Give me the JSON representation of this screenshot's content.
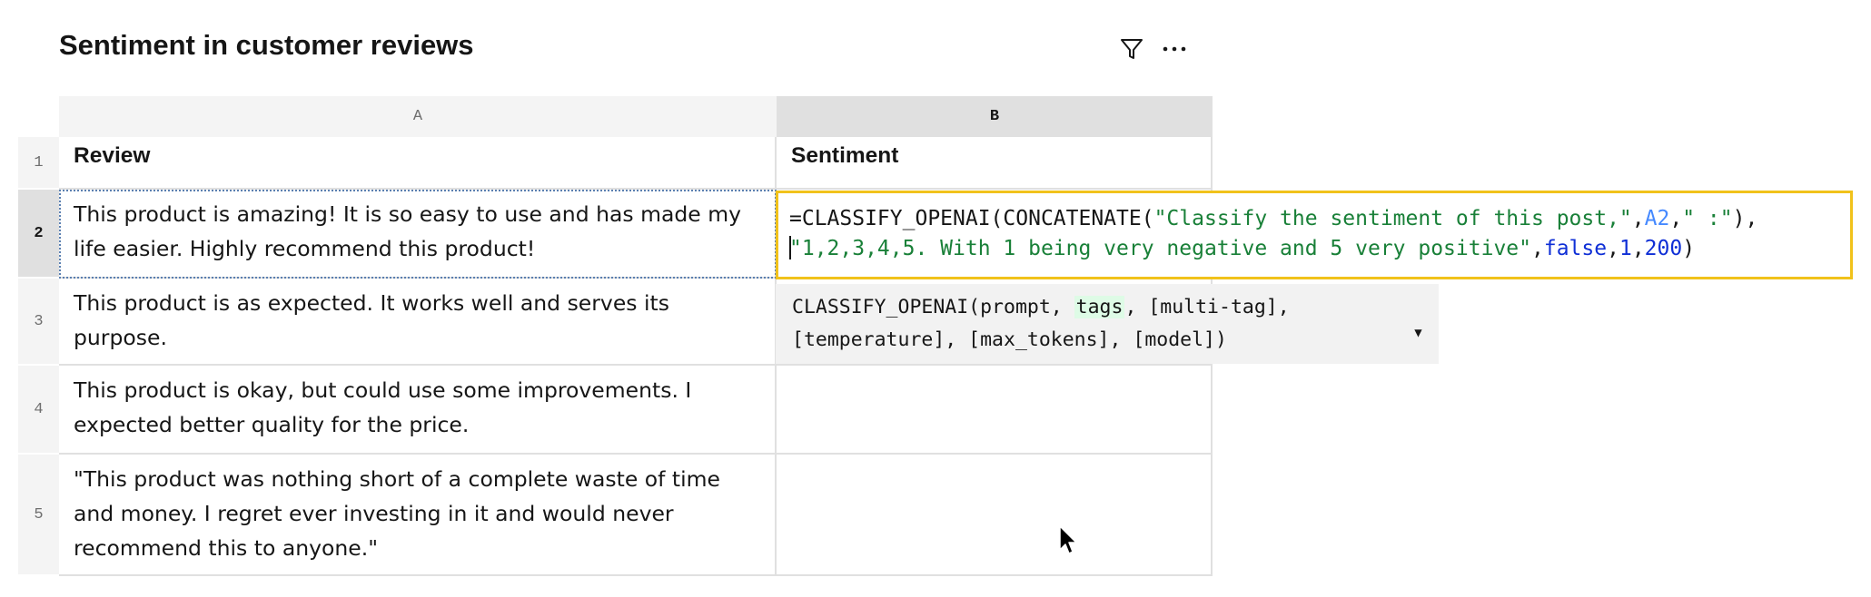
{
  "title": "Sentiment in customer reviews",
  "toolbar": {
    "filter_icon": "filter-icon",
    "more_icon": "more-horizontal-icon"
  },
  "columns": [
    "A",
    "B"
  ],
  "rows": [
    {
      "num": "1",
      "a": "Review",
      "b": "Sentiment"
    },
    {
      "num": "2",
      "a": "This product is amazing! It is so easy to use and has made my life easier. Highly recommend this product!",
      "b": ""
    },
    {
      "num": "3",
      "a": "This product is as expected. It works well and serves its purpose.",
      "b": ""
    },
    {
      "num": "4",
      "a": "This product is okay, but could use some improvements. I expected better quality for the price.",
      "b": ""
    },
    {
      "num": "5",
      "a": "\"This product was nothing short of a complete waste of time and money. I regret ever investing in it and would never recommend this to anyone.\"",
      "b": ""
    }
  ],
  "formula": {
    "line1": {
      "p1": "=CLASSIFY_OPENAI(CONCATENATE(",
      "s1": "\"Classify the sentiment of this post,\"",
      "c1": ",",
      "ref": "A2",
      "c2": ",",
      "s2": "\" :\"",
      "p2": "),"
    },
    "line2": {
      "s3": "\"1,2,3,4,5. With 1 being very negative and 5 very positive\"",
      "c3": ",",
      "kw": "false",
      "c4": ",",
      "n1": "1",
      "c5": ",",
      "n2": "200",
      "p3": ")"
    }
  },
  "hint": {
    "pre": "CLASSIFY_OPENAI(prompt, ",
    "highlight": "tags",
    "post1": ", [multi-tag],",
    "line2": "[temperature], [max_tokens], [model])",
    "caret": "▾"
  },
  "colors": {
    "highlight_border": "#f1c21b",
    "string": "#198038",
    "ref": "#4589ff",
    "keyword": "#0f2fd6"
  }
}
